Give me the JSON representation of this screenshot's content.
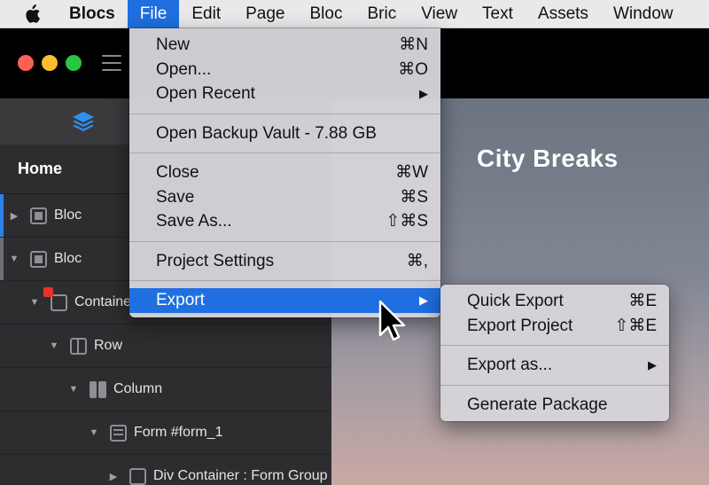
{
  "menubar": {
    "app_name": "Blocs",
    "items": [
      "File",
      "Edit",
      "Page",
      "Bloc",
      "Bric",
      "View",
      "Text",
      "Assets",
      "Window"
    ],
    "active": "File"
  },
  "window": {
    "traffic_lights": [
      "#fe5f57",
      "#febc2e",
      "#27c840"
    ]
  },
  "sidebar": {
    "home_label": "Home",
    "tree": [
      {
        "label": "Bloc",
        "icon": "square-outline-icon",
        "expanded": false
      },
      {
        "label": "Bloc",
        "icon": "square-outline-icon",
        "expanded": true
      },
      {
        "label": "Container",
        "icon": "container-icon",
        "expanded": true,
        "locked": true
      },
      {
        "label": "Row",
        "icon": "row-icon",
        "expanded": true
      },
      {
        "label": "Column",
        "icon": "column-icon",
        "expanded": true
      },
      {
        "label": "Form #form_1",
        "icon": "form-icon",
        "expanded": true
      },
      {
        "label": "Div Container : Form Group",
        "icon": "square-outline-icon",
        "expanded": false
      }
    ]
  },
  "canvas": {
    "heading": "City Breaks"
  },
  "file_menu": {
    "items": [
      {
        "label": "New",
        "shortcut": "⌘N"
      },
      {
        "label": "Open...",
        "shortcut": "⌘O"
      },
      {
        "label": "Open Recent",
        "shortcut": "▶"
      },
      {
        "label": "Open Backup Vault - 7.88 GB",
        "shortcut": ""
      },
      {
        "label": "Close",
        "shortcut": "⌘W"
      },
      {
        "label": "Save",
        "shortcut": "⌘S"
      },
      {
        "label": "Save As...",
        "shortcut": "⇧⌘S"
      },
      {
        "label": "Project Settings",
        "shortcut": "⌘,"
      },
      {
        "label": "Export",
        "shortcut": "▶"
      }
    ],
    "highlighted": "Export"
  },
  "export_menu": {
    "items": [
      {
        "label": "Quick Export",
        "shortcut": "⌘E"
      },
      {
        "label": "Export Project",
        "shortcut": "⇧⌘E"
      },
      {
        "label": "Export as...",
        "shortcut": "▶"
      },
      {
        "label": "Generate Package",
        "shortcut": ""
      }
    ]
  },
  "colors": {
    "accent": "#1f6fe0",
    "row_accent_blue": "#2f7fe8",
    "sidebar_bg": "#2d2d30"
  }
}
